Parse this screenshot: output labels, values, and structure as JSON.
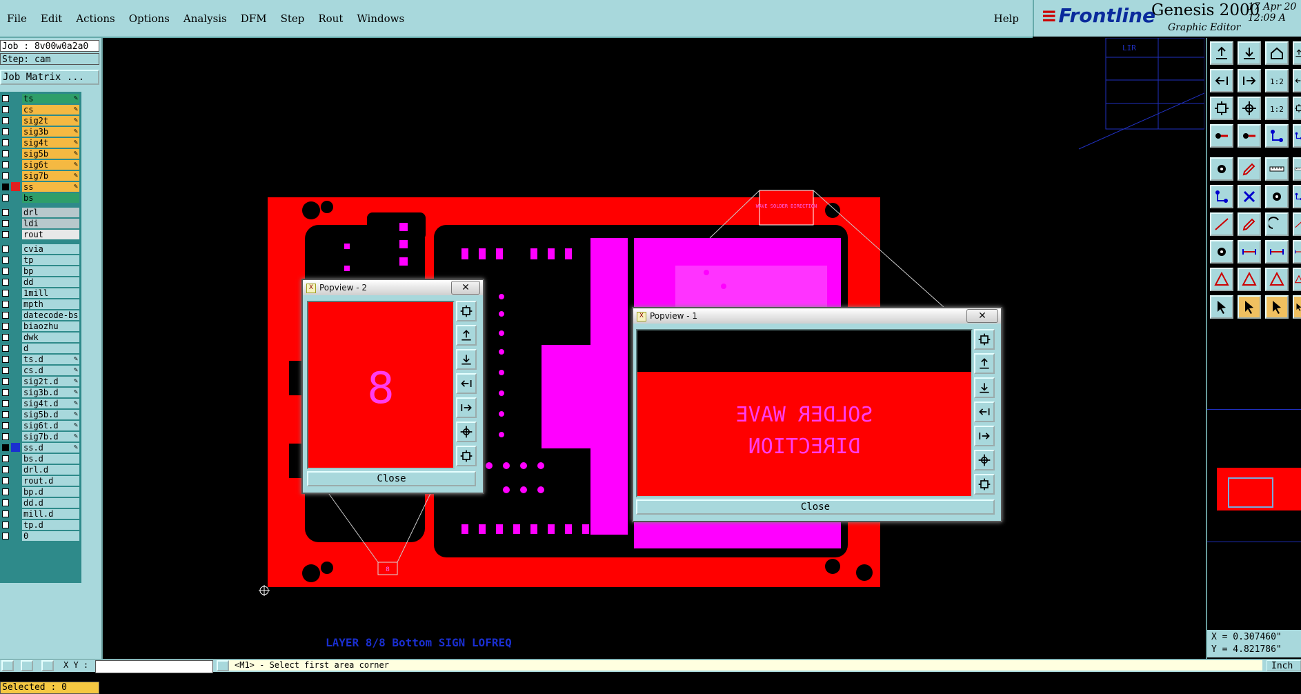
{
  "menubar": {
    "items": [
      "File",
      "Edit",
      "Actions",
      "Options",
      "Analysis",
      "DFM",
      "Step",
      "Rout",
      "Windows"
    ],
    "help": "Help"
  },
  "brand": {
    "logo": "Frontline",
    "product": "Genesis 2000",
    "subtitle": "Graphic Editor",
    "date": "17 Apr 20",
    "time": "12:09 A"
  },
  "job": {
    "job_line": "Job : 8v00w0a2a0",
    "step_line": "Step: cam",
    "matrix_button": "Job Matrix ..."
  },
  "layers": {
    "board": [
      {
        "name": "ts",
        "color": "#2e9e6a",
        "editable": true
      },
      {
        "name": "cs",
        "color": "#f5b942",
        "editable": true
      },
      {
        "name": "sig2t",
        "color": "#f5b942",
        "editable": true
      },
      {
        "name": "sig3b",
        "color": "#f5b942",
        "editable": true
      },
      {
        "name": "sig4t",
        "color": "#f5b942",
        "editable": true
      },
      {
        "name": "sig5b",
        "color": "#f5b942",
        "editable": true
      },
      {
        "name": "sig6t",
        "color": "#f5b942",
        "editable": true
      },
      {
        "name": "sig7b",
        "color": "#f5b942",
        "editable": true
      },
      {
        "name": "ss",
        "color": "#f5b942",
        "editable": true,
        "swatch": "#e02020",
        "checked": true
      },
      {
        "name": "bs",
        "color": "#2e9e6a",
        "editable": false
      }
    ],
    "drill": [
      {
        "name": "drl",
        "color": "#b8c8cc"
      },
      {
        "name": "ldi",
        "color": "#b8c8cc"
      },
      {
        "name": "rout",
        "color": "#e8e8e8"
      }
    ],
    "misc": [
      {
        "name": "cvia",
        "editable": false
      },
      {
        "name": "tp",
        "editable": false
      },
      {
        "name": "bp",
        "editable": false
      },
      {
        "name": "dd",
        "editable": false
      },
      {
        "name": "1mill",
        "editable": false
      },
      {
        "name": "mpth",
        "editable": false
      },
      {
        "name": "datecode-bs",
        "editable": false
      },
      {
        "name": "biaozhu",
        "editable": false
      },
      {
        "name": "dwk",
        "editable": false
      },
      {
        "name": "d",
        "editable": false
      },
      {
        "name": "ts.d",
        "editable": true
      },
      {
        "name": "cs.d",
        "editable": true
      },
      {
        "name": "sig2t.d",
        "editable": true
      },
      {
        "name": "sig3b.d",
        "editable": true
      },
      {
        "name": "sig4t.d",
        "editable": true
      },
      {
        "name": "sig5b.d",
        "editable": true
      },
      {
        "name": "sig6t.d",
        "editable": true
      },
      {
        "name": "sig7b.d",
        "editable": true
      },
      {
        "name": "ss.d",
        "editable": true,
        "swatch": "#1a2fd0",
        "checked": true
      },
      {
        "name": "bs.d",
        "editable": false
      },
      {
        "name": "drl.d",
        "editable": false
      },
      {
        "name": "rout.d",
        "editable": false
      },
      {
        "name": "bp.d",
        "editable": false
      },
      {
        "name": "dd.d",
        "editable": false
      },
      {
        "name": "mill.d",
        "editable": false
      },
      {
        "name": "tp.d",
        "editable": false
      },
      {
        "name": "0",
        "editable": false
      }
    ]
  },
  "selected": "Selected : 0",
  "bottom": {
    "xy_label": "X Y :",
    "prompt": "<M1> - Select first area corner",
    "units": "Inch"
  },
  "coords": {
    "x": "X = 0.307460\"",
    "y": "Y = 4.821786\""
  },
  "canvas": {
    "layer_label": "LAYER 8/8 Bottom SIGN LOFREQ",
    "mini_label": "LIR",
    "top_callout": "WAVE SOLDER DIRECTION",
    "bottom_callout": "8"
  },
  "popup2": {
    "title": "Popview - 2",
    "close": "Close",
    "content": "8"
  },
  "popup1": {
    "title": "Popview - 1",
    "close": "Close",
    "content_line1": "SOLDER WAVE",
    "content_line2": "DIRECTION"
  },
  "colors": {
    "board": "#ff0000",
    "copper": "#ff00ff",
    "panel": "#a8d8dc",
    "selected": "#f5c842"
  }
}
